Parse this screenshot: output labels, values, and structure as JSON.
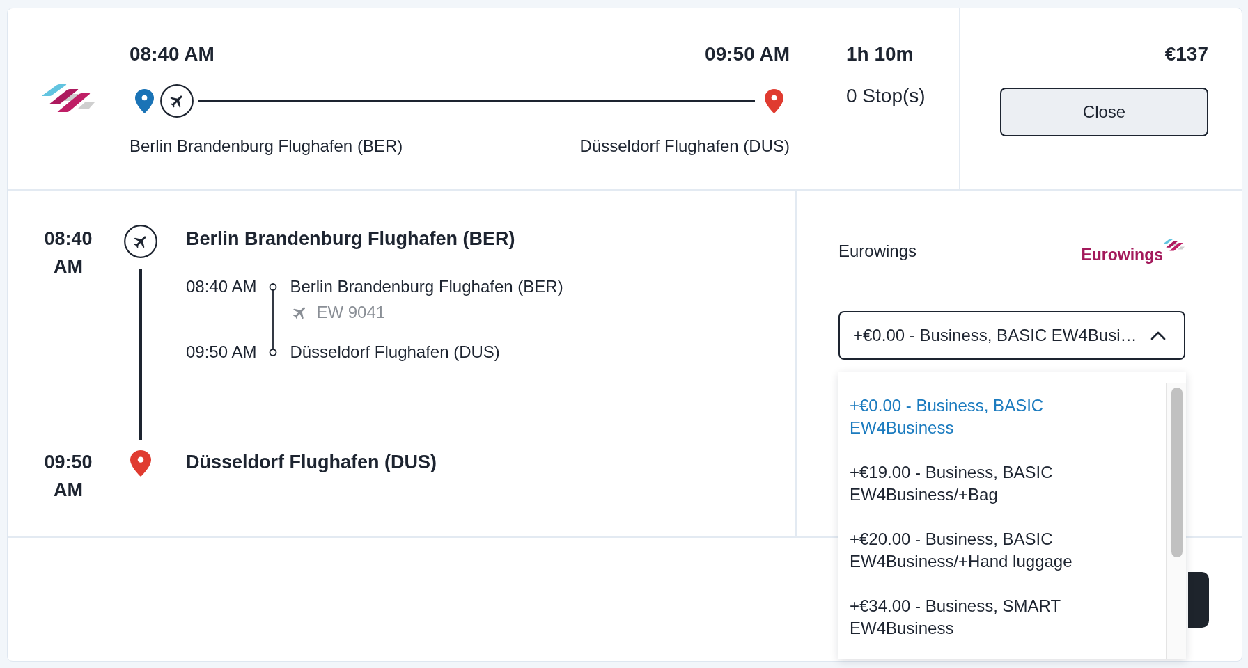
{
  "flight_summary": {
    "departure": {
      "time": "08:40 AM",
      "airport": "Berlin Brandenburg Flughafen (BER)"
    },
    "arrival": {
      "time": "09:50 AM",
      "airport": "Düsseldorf Flughafen (DUS)"
    },
    "duration": "1h 10m",
    "stops": "0 Stop(s)",
    "price": "€137",
    "close_button": "Close"
  },
  "itinerary": {
    "origin": {
      "time": "08:40 AM",
      "airport": "Berlin Brandenburg Flughafen (BER)"
    },
    "segments": [
      {
        "departure_time": "08:40 AM",
        "departure_airport": "Berlin Brandenburg Flughafen (BER)",
        "flight_number": "EW 9041",
        "arrival_time": "09:50 AM",
        "arrival_airport": "Düsseldorf Flughafen (DUS)"
      }
    ],
    "destination": {
      "time": "09:50 AM",
      "airport": "Düsseldorf Flughafen (DUS)"
    }
  },
  "fare_panel": {
    "airline": "Eurowings",
    "logo_text": "Eurowings",
    "fare_select": {
      "value": "+€0.00 - Business, BASIC EW4Busi…",
      "expanded": true
    },
    "fare_options": [
      {
        "label": "+€0.00 - Business, BASIC EW4Business",
        "selected": true
      },
      {
        "label": "+€19.00 - Business, BASIC EW4Business/+Bag",
        "selected": false
      },
      {
        "label": "+€20.00 - Business, BASIC EW4Business/+Hand luggage",
        "selected": false
      },
      {
        "label": "+€34.00 - Business, SMART EW4Business",
        "selected": false
      }
    ]
  }
}
